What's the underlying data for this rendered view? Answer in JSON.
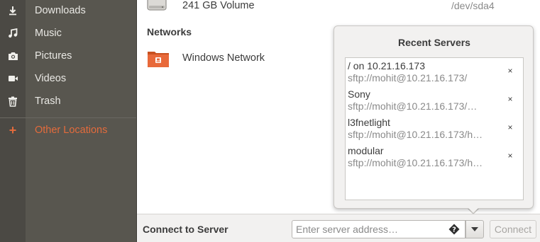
{
  "sidebar": {
    "items": [
      {
        "label": "Downloads",
        "icon": "download-icon"
      },
      {
        "label": "Music",
        "icon": "music-icon"
      },
      {
        "label": "Pictures",
        "icon": "camera-icon"
      },
      {
        "label": "Videos",
        "icon": "video-icon"
      },
      {
        "label": "Trash",
        "icon": "trash-icon"
      }
    ],
    "other_locations": {
      "label": "Other Locations",
      "icon": "plus-icon"
    }
  },
  "volume": {
    "name": "241 GB Volume",
    "device": "/dev/sda4",
    "icon": "harddisk-icon"
  },
  "networks": {
    "title": "Networks",
    "items": [
      {
        "label": "Windows Network",
        "icon": "network-folder-icon"
      }
    ]
  },
  "connect_bar": {
    "label": "Connect to Server",
    "placeholder": "Enter server address…",
    "help_icon": "question-icon",
    "connect_label": "Connect"
  },
  "recent_servers": {
    "title": "Recent Servers",
    "items": [
      {
        "name": "/ on 10.21.16.173",
        "uri": "sftp://mohit@10.21.16.173/"
      },
      {
        "name": "Sony",
        "uri": "sftp://mohit@10.21.16.173/…"
      },
      {
        "name": "l3fnetlight",
        "uri": "sftp://mohit@10.21.16.173/h…"
      },
      {
        "name": "modular",
        "uri": "sftp://mohit@10.21.16.173/h…"
      }
    ],
    "remove_glyph": "×"
  },
  "colors": {
    "sidebar_bg": "#58564f",
    "accent": "#e36b3c",
    "bottombar_bg": "#f2f1f0"
  }
}
